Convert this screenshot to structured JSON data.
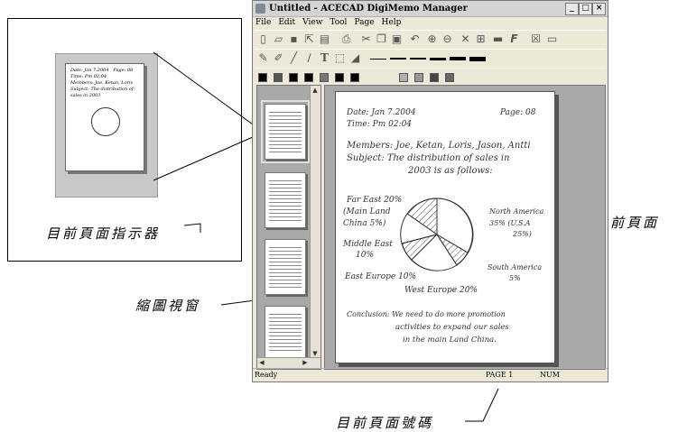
{
  "window": {
    "title": "Untitled - ACECAD DigiMemo Manager"
  },
  "menu": [
    "File",
    "Edit",
    "View",
    "Tool",
    "Page",
    "Help"
  ],
  "toolbar_icons": [
    "new-icon",
    "open-icon",
    "save-icon",
    "export-icon",
    "import-icon",
    "print-icon",
    "cut-icon",
    "copy-icon",
    "paste-icon",
    "undo-icon",
    "zoom-in-icon",
    "zoom-out-icon",
    "delete-icon",
    "fit-icon",
    "image-icon",
    "font-icon",
    "close-doc-icon",
    "page-icon"
  ],
  "colors": {
    "swatches": [
      "#000000",
      "#555555",
      "#000000",
      "#000000",
      "#777777",
      "#000000",
      "#000000",
      "#b0b0b0",
      "#999999",
      "#444444",
      "#666666"
    ],
    "pane_bg": "#a9a9a9",
    "window_bg": "#ece9d8"
  },
  "document": {
    "date": "Date: Jan 7.2004",
    "page": "Page: 08",
    "time": "Time: Pm 02:04",
    "members": "Members: Joe, Ketan, Loris, Jason, Antti",
    "subject_1": "Subject: The distribution of sales in",
    "subject_2": "2003 is as follows:",
    "far_east_1": "Far East 20%",
    "far_east_2": "(Main Land",
    "far_east_3": "China 5%)",
    "middle_east_1": "Middle East",
    "middle_east_2": "10%",
    "east_europe": "East Europe 10%",
    "west_europe": "West Europe 20%",
    "north_america_1": "North America",
    "north_america_2": "35% (U.S.A",
    "north_america_3": "25%)",
    "south_america_1": "South America",
    "south_america_2": "5%",
    "conclusion_1": "Conclusion: We need to do more promotion",
    "conclusion_2": "activities to expand our sales",
    "conclusion_3": "in the main Land China."
  },
  "status": {
    "left": "Ready",
    "page": "PAGE 1",
    "num": "NUM"
  },
  "annotations": {
    "page_indicator": "目前頁面指示器",
    "current_page": "目前頁面",
    "thumbnail_window": "縮圖視窗",
    "page_number": "目前頁面號碼"
  }
}
